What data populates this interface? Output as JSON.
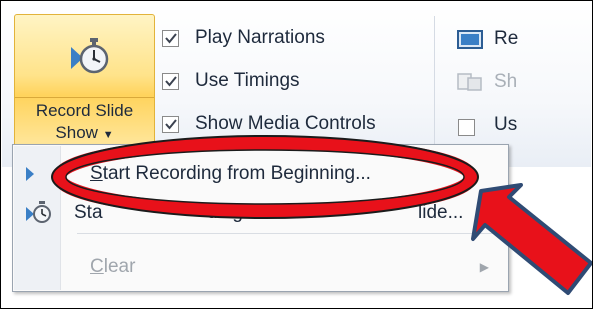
{
  "ribbon": {
    "record_button": {
      "line1": "Record Slide",
      "line2": "Show"
    },
    "checkboxes": [
      {
        "label": "Play Narrations",
        "checked": true
      },
      {
        "label": "Use Timings",
        "checked": true
      },
      {
        "label": "Show Media Controls",
        "checked": true
      }
    ],
    "right_group": [
      {
        "label": "Re",
        "icon": "resolution-icon"
      },
      {
        "label": "Sh",
        "icon": "show-presenter-icon"
      },
      {
        "label": "Us",
        "icon": "checkbox-icon"
      }
    ]
  },
  "menu": {
    "items": [
      {
        "label": "Start Recording from Beginning...",
        "mnemonic": "S",
        "rest": "tart Recording from Beginning...",
        "enabled": true
      },
      {
        "label": "Start Recording from Current Slide...",
        "visible_fragment_left": "Sta",
        "visible_fragment_mid": "ding from C",
        "visible_fragment_right": "lide...",
        "enabled": true
      },
      {
        "label": "Clear",
        "mnemonic": "C",
        "rest": "lear",
        "enabled": false
      }
    ]
  },
  "annotation": {
    "ellipse_color": "#e8111a",
    "arrow_color": "#e8111a",
    "arrow_outline": "#2f4b74"
  },
  "colors": {
    "button_highlight": "#ffd35c",
    "text": "#1e2a3c",
    "disabled_text": "#a0a6ad"
  }
}
